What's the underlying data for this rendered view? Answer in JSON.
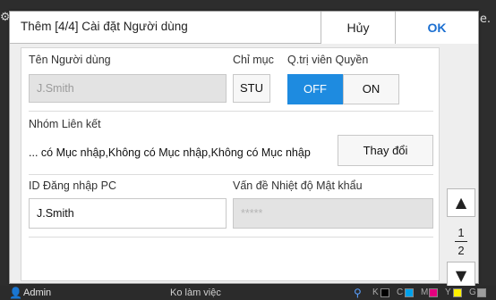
{
  "background": {
    "right_text": "e."
  },
  "dialog": {
    "title": "Thêm [4/4] Cài đặt Người dùng",
    "cancel_label": "Hủy",
    "ok_label": "OK"
  },
  "form": {
    "username": {
      "label": "Tên Người dùng",
      "value": "J.Smith"
    },
    "index": {
      "label": "Chỉ mục",
      "value": "STU"
    },
    "admin_rights": {
      "label": "Q.trị viên Quyền",
      "off_label": "OFF",
      "on_label": "ON",
      "selected": "OFF"
    },
    "linked_group": {
      "label": "Nhóm Liên kết",
      "value": "... có Mục nhập,Không có Mục nhập,Không có Mục nhập",
      "change_label": "Thay đổi"
    },
    "pc_login_id": {
      "label": "ID Đăng nhập PC",
      "value": "J.Smith"
    },
    "password_issue": {
      "label": "Vấn đề Nhiệt độ Mật khẩu",
      "value": "*****"
    }
  },
  "pager": {
    "current": "1",
    "total": "2",
    "up_icon": "triangle-up-icon",
    "down_icon": "triangle-down-icon"
  },
  "status": {
    "user": "Admin",
    "mode": "Ko làm việc",
    "inks": [
      {
        "label": "K",
        "color": "#000000"
      },
      {
        "label": "C",
        "color": "#00a0e9"
      },
      {
        "label": "M",
        "color": "#e4007f"
      },
      {
        "label": "Y",
        "color": "#fff100"
      },
      {
        "label": "G",
        "color": "#9e9e9e"
      }
    ]
  },
  "colors": {
    "accent": "#1e8be0",
    "ok_text": "#1b6fd1"
  }
}
